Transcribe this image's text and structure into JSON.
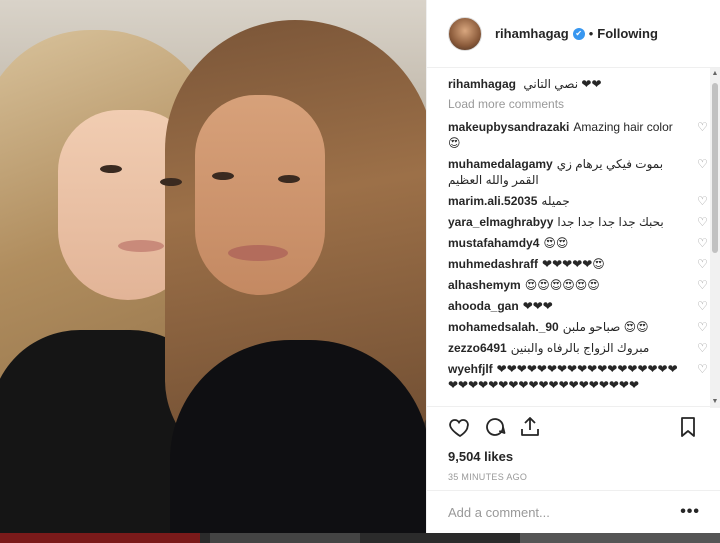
{
  "header": {
    "username": "rihamhagag",
    "verified_mark": "✔",
    "separator": "•",
    "follow_status": "Following"
  },
  "caption": {
    "username": "rihamhagag",
    "text": "نصي التاني ❤❤"
  },
  "load_more": "Load more comments",
  "comments": [
    {
      "user": "makeupbysandrazaki",
      "text": "Amazing hair color😍"
    },
    {
      "user": "muhamedalagamy",
      "text": "بموت فيكي يرهام زي القمر والله العظيم"
    },
    {
      "user": "marim.ali.52035",
      "text": "جميله"
    },
    {
      "user": "yara_elmaghrabyy",
      "text": "بحبك جدا جدا جدا جدا"
    },
    {
      "user": "mustafahamdy4",
      "text": "😍😍"
    },
    {
      "user": "muhmedashraff",
      "text": "❤❤❤❤❤😍"
    },
    {
      "user": "alhashemym",
      "text": "😍😍😍😍😍😍"
    },
    {
      "user": "ahooda_gan",
      "text": "❤❤❤"
    },
    {
      "user": "mohamedsalah._90",
      "text": "صباحو ملبن 😍😍"
    },
    {
      "user": "zezzo6491",
      "text": "مبروك الزواج بالرفاه والبنين"
    },
    {
      "user": "wyehfjlf",
      "text": "❤❤❤❤❤❤❤❤❤❤❤❤❤❤❤❤❤❤❤❤❤❤❤❤❤❤❤❤❤❤❤❤❤❤❤❤❤"
    }
  ],
  "comment_like_icon": "♡",
  "likes": "9,504 likes",
  "timestamp": "35 MINUTES AGO",
  "add_comment_placeholder": "Add a comment...",
  "more_options": "•••",
  "scroll_up": "▲",
  "scroll_down": "▼",
  "colors": {
    "verified": "#3897f0",
    "text": "#262626",
    "muted": "#999999"
  }
}
